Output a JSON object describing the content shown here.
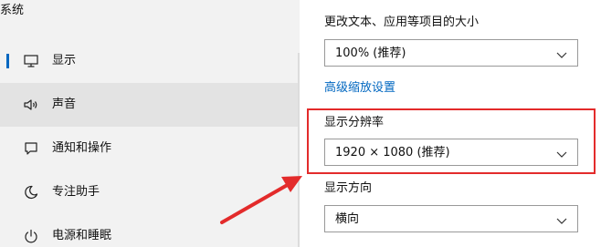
{
  "sidebar": {
    "title": "系统",
    "items": [
      {
        "label": "显示",
        "icon": "monitor-icon"
      },
      {
        "label": "声音",
        "icon": "speaker-icon"
      },
      {
        "label": "通知和操作",
        "icon": "notification-icon"
      },
      {
        "label": "专注助手",
        "icon": "moon-icon"
      },
      {
        "label": "电源和睡眠",
        "icon": "power-icon"
      }
    ]
  },
  "main": {
    "scale_label": "更改文本、应用等项目的大小",
    "scale_value": "100% (推荐)",
    "advanced_scaling_link": "高级缩放设置",
    "resolution_label": "显示分辨率",
    "resolution_value": "1920 × 1080 (推荐)",
    "orientation_label": "显示方向",
    "orientation_value": "横向"
  },
  "colors": {
    "accent": "#0067c0",
    "annotation_red": "#e32b2b"
  }
}
